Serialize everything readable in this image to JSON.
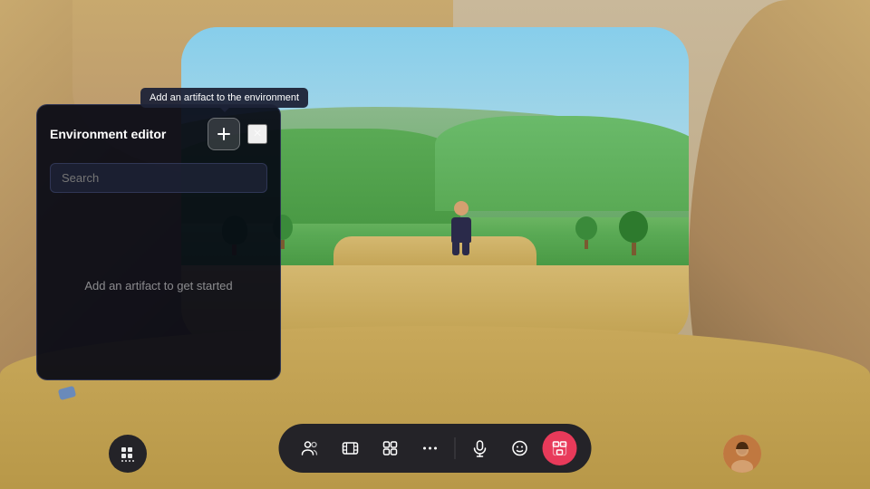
{
  "scene": {
    "bg_color_top": "#c9b89a",
    "bg_color_bottom": "#b5a07a"
  },
  "tooltip": {
    "text": "Add an artifact to the environment"
  },
  "editor_panel": {
    "title": "Environment editor",
    "add_button_label": "+",
    "close_label": "×",
    "search_placeholder": "Search",
    "empty_state_text": "Add an artifact to get started"
  },
  "toolbar": {
    "buttons": [
      {
        "id": "people",
        "icon": "people",
        "label": "People"
      },
      {
        "id": "media",
        "icon": "film",
        "label": "Media"
      },
      {
        "id": "content",
        "icon": "content",
        "label": "Content"
      },
      {
        "id": "more",
        "icon": "more",
        "label": "More"
      },
      {
        "id": "mic",
        "icon": "mic",
        "label": "Microphone"
      },
      {
        "id": "emoji",
        "icon": "emoji",
        "label": "Emoji"
      },
      {
        "id": "share",
        "icon": "share",
        "label": "Share",
        "active": true
      }
    ],
    "left_button": {
      "id": "grid",
      "icon": "grid",
      "label": "Grid"
    },
    "right_avatar": {
      "label": "User avatar"
    }
  }
}
